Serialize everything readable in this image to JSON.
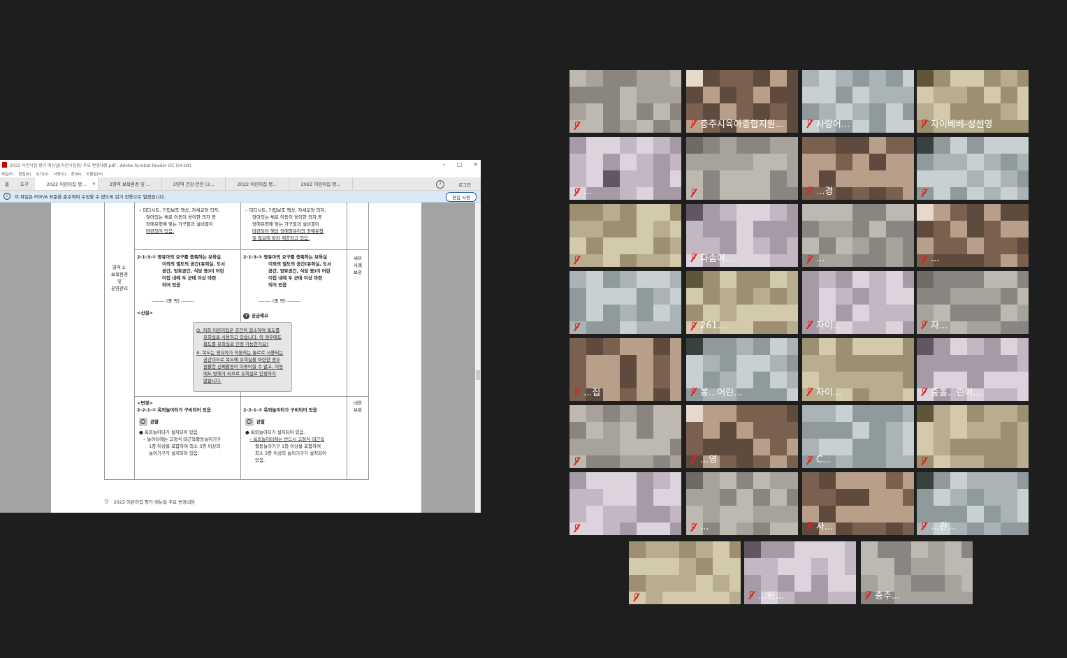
{
  "acrobat": {
    "title": "2022 어린이집 평가 매뉴얼(어린이집용) 주요 변경내용.pdf - Adobe Acrobat Reader DC (64-bit)",
    "win_minimize": "–",
    "win_maximize": "□",
    "win_close": "✕",
    "menu": [
      "파일(F)",
      "편집(E)",
      "보기(V)",
      "서명(S)",
      "창(W)",
      "도움말(H)"
    ],
    "home_tab": "홈",
    "tools_tab": "도구",
    "tabs": [
      "2022 어린이집 평...",
      "2영역 보육환경 및 ...",
      "3영역 건강·안전 (2...",
      "2022 어린이집 평...",
      "2022 어린이집 평..."
    ],
    "active_tab_close": "×",
    "help": "?",
    "login": "로그인",
    "info_icon": "i",
    "info_text": "이 파일은 PDF/A 표준을 준수하며 수정할 수 없도록 읽기 전용으로 열렸습니다.",
    "edit_button": "편집 사용",
    "doc": {
      "area_label": [
        "영역 2.",
        "보육환경",
        "및",
        "운영관리"
      ],
      "left_top": [
        "– 피디시트, 기립보조 책상, 자세교정 의자,",
        "앉아있는 채로 이동이 용이한 의자 등",
        "장애유형에 맞는 가구들과 설비들이",
        "마련되어 있음."
      ],
      "right_top": [
        "– 피디시트, 기립보조 책상, 자세교정 의자,",
        "앉아있는 채로 이동이 용이한 의자 등",
        "장애유형에 맞는 가구들과 설비들이",
        "마련되어 해당 장애영유아의 장애유형",
        "및 필요에 따라 제공되고 있음."
      ],
      "item_213": [
        "2-1-3-① 영유아의 요구를 충족하는 보육실",
        "이외의 별도의 공간(유희실, 도서",
        "공간, 양호공간, 식당 등)이 어린",
        "이집 내에 두 군데 이상 마련",
        "되어 있음"
      ],
      "omitted": "-------- (중 략) --------",
      "new_label": "<신설>",
      "faq_title": "궁금해요",
      "faq_q": [
        "Q. 저희 어린이집은 공간이 협소하여 복도를",
        "유희실로 사용하고 있습니다. 이 경우에도",
        "복도를 유희실로 인정 가능한가요?"
      ],
      "faq_a": [
        "A. 복도는 영유아가 이동하는 통로로 사용되는",
        "공간이므로 복도에 유희실을 마련한 경우",
        "원활한 신체활동이 이루어질 수 없고, 이동",
        "에도 방해가 되므로 유희실로 인정하지",
        "않습니다."
      ],
      "remark_1": [
        "세부",
        "사례",
        "보완"
      ],
      "change_label": "<변경>",
      "item_221": "2-2-1-① 옥외놀이터가 구비되어 있음",
      "observe": "관찰",
      "left_bottom": [
        "● 옥외놀이터가 설치되어 있음.",
        "– 놀이터에는 고정식 대근육활동놀이기구",
        "1종 이상을 포함하여 최소 3종 이상의",
        "놀이기구가 설치되어 있음."
      ],
      "right_bottom": [
        "● 옥외놀이터가 설치되어 있음.",
        "– 옥외놀이터에는 반드시 고정식 대근육",
        "활동놀이기구 1종 이상을 포함하여",
        "최소 3종 이상의 놀이기구가 설치되어",
        "있음."
      ],
      "remark_2": [
        "내용",
        "보완"
      ],
      "page_no": "9",
      "footer": "2022 어린이집 평가 매뉴얼 주요 변경내용"
    }
  },
  "gallery": {
    "tiles": [
      {
        "name": ""
      },
      {
        "name": "충주시육아종합지원..."
      },
      {
        "name": "사랑어..."
      },
      {
        "name": "자이베베-성선영"
      },
      {
        "name": "..."
      },
      {
        "name": ""
      },
      {
        "name": "...경"
      },
      {
        "name": "",
        "speaking": true
      },
      {
        "name": ""
      },
      {
        "name": "다솜어..."
      },
      {
        "name": "..."
      },
      {
        "name": "..."
      },
      {
        "name": ""
      },
      {
        "name": "261..."
      },
      {
        "name": "자이..."
      },
      {
        "name": "자..."
      },
      {
        "name": "...집"
      },
      {
        "name": "봉...어린..."
      },
      {
        "name": "자이..."
      },
      {
        "name": "충홀...린이..."
      },
      {
        "name": ""
      },
      {
        "name": "...영"
      },
      {
        "name": "C..."
      },
      {
        "name": ""
      },
      {
        "name": ""
      },
      {
        "name": "..."
      },
      {
        "name": "사..."
      },
      {
        "name": "...란..."
      },
      {
        "name": ""
      },
      {
        "name": "...린..."
      },
      {
        "name": "충주..."
      }
    ]
  }
}
